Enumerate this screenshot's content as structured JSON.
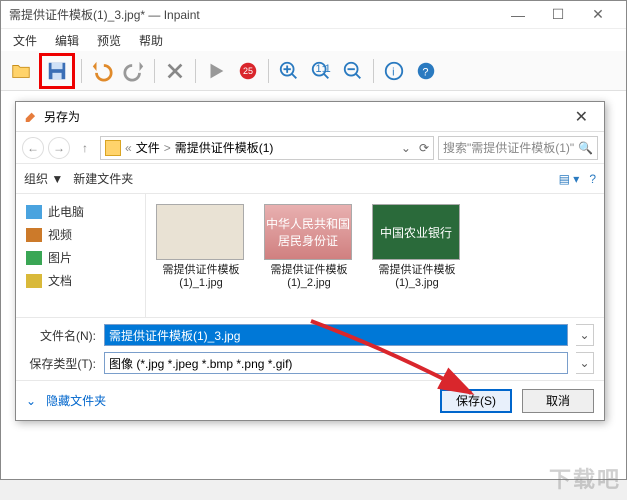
{
  "window": {
    "title": "需提供证件模板(1)_3.jpg* — Inpaint",
    "menu": {
      "file": "文件",
      "edit": "编辑",
      "view": "预览",
      "help": "帮助"
    }
  },
  "toolbar": {
    "badge": "25"
  },
  "dialog": {
    "title": "另存为",
    "breadcrumb": {
      "sep": "«",
      "root": "文件",
      "arrow": ">",
      "folder": "需提供证件模板(1)"
    },
    "search_placeholder": "搜索\"需提供证件模板(1)\"",
    "organize": "组织 ▼",
    "newfolder": "新建文件夹",
    "sidebar": {
      "this_pc": "此电脑",
      "videos": "视频",
      "pictures": "图片",
      "documents": "文档"
    },
    "files": [
      {
        "name": "需提供证件模板(1)_1.jpg",
        "kind": "doc"
      },
      {
        "name": "需提供证件模板(1)_2.jpg",
        "kind": "idcard",
        "preview": "中华人民共和国\n居民身份证"
      },
      {
        "name": "需提供证件模板(1)_3.jpg",
        "kind": "bank",
        "preview": "中国农业银行"
      }
    ],
    "filename_label": "文件名(N):",
    "filename_value": "需提供证件模板(1)_3.jpg",
    "filetype_label": "保存类型(T):",
    "filetype_value": "图像 (*.jpg *.jpeg *.bmp *.png *.gif)",
    "hide_folders": "隐藏文件夹",
    "save": "保存(S)",
    "cancel": "取消"
  },
  "watermark": "下载吧"
}
